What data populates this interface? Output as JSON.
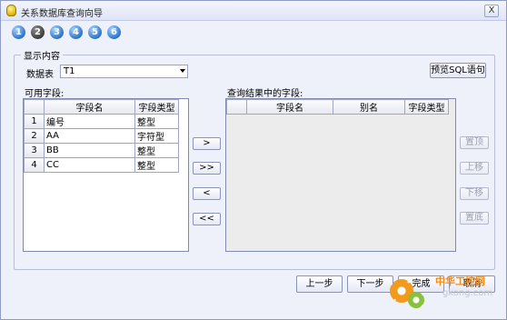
{
  "window": {
    "title": "关系数据库查询向导",
    "close": "X"
  },
  "steps": [
    "1",
    "2",
    "3",
    "4",
    "5",
    "6"
  ],
  "active_step": 2,
  "display_group": {
    "legend": "显示内容"
  },
  "datatable": {
    "label": "数据表",
    "value": "T1"
  },
  "preview_button": "预览SQL语句",
  "available": {
    "label": "可用字段:",
    "headers": [
      "字段名",
      "字段类型"
    ],
    "rows": [
      {
        "num": "1",
        "name": "编号",
        "type": "整型"
      },
      {
        "num": "2",
        "name": "AA",
        "type": "字符型"
      },
      {
        "num": "3",
        "name": "BB",
        "type": "整型"
      },
      {
        "num": "4",
        "name": "CC",
        "type": "整型"
      }
    ]
  },
  "selected": {
    "label": "查询结果中的字段:",
    "headers": [
      "字段名",
      "别名",
      "字段类型"
    ]
  },
  "move_buttons": {
    "add": ">",
    "add_all": ">>",
    "remove": "<",
    "remove_all": "<<"
  },
  "order_buttons": {
    "top": "置顶",
    "up": "上移",
    "down": "下移",
    "bottom": "置底"
  },
  "nav_buttons": {
    "prev": "上一步",
    "next": "下一步",
    "finish": "完成",
    "cancel": "取消"
  },
  "watermark": {
    "text1": "中华工控网",
    "text2": "gkong.com"
  }
}
